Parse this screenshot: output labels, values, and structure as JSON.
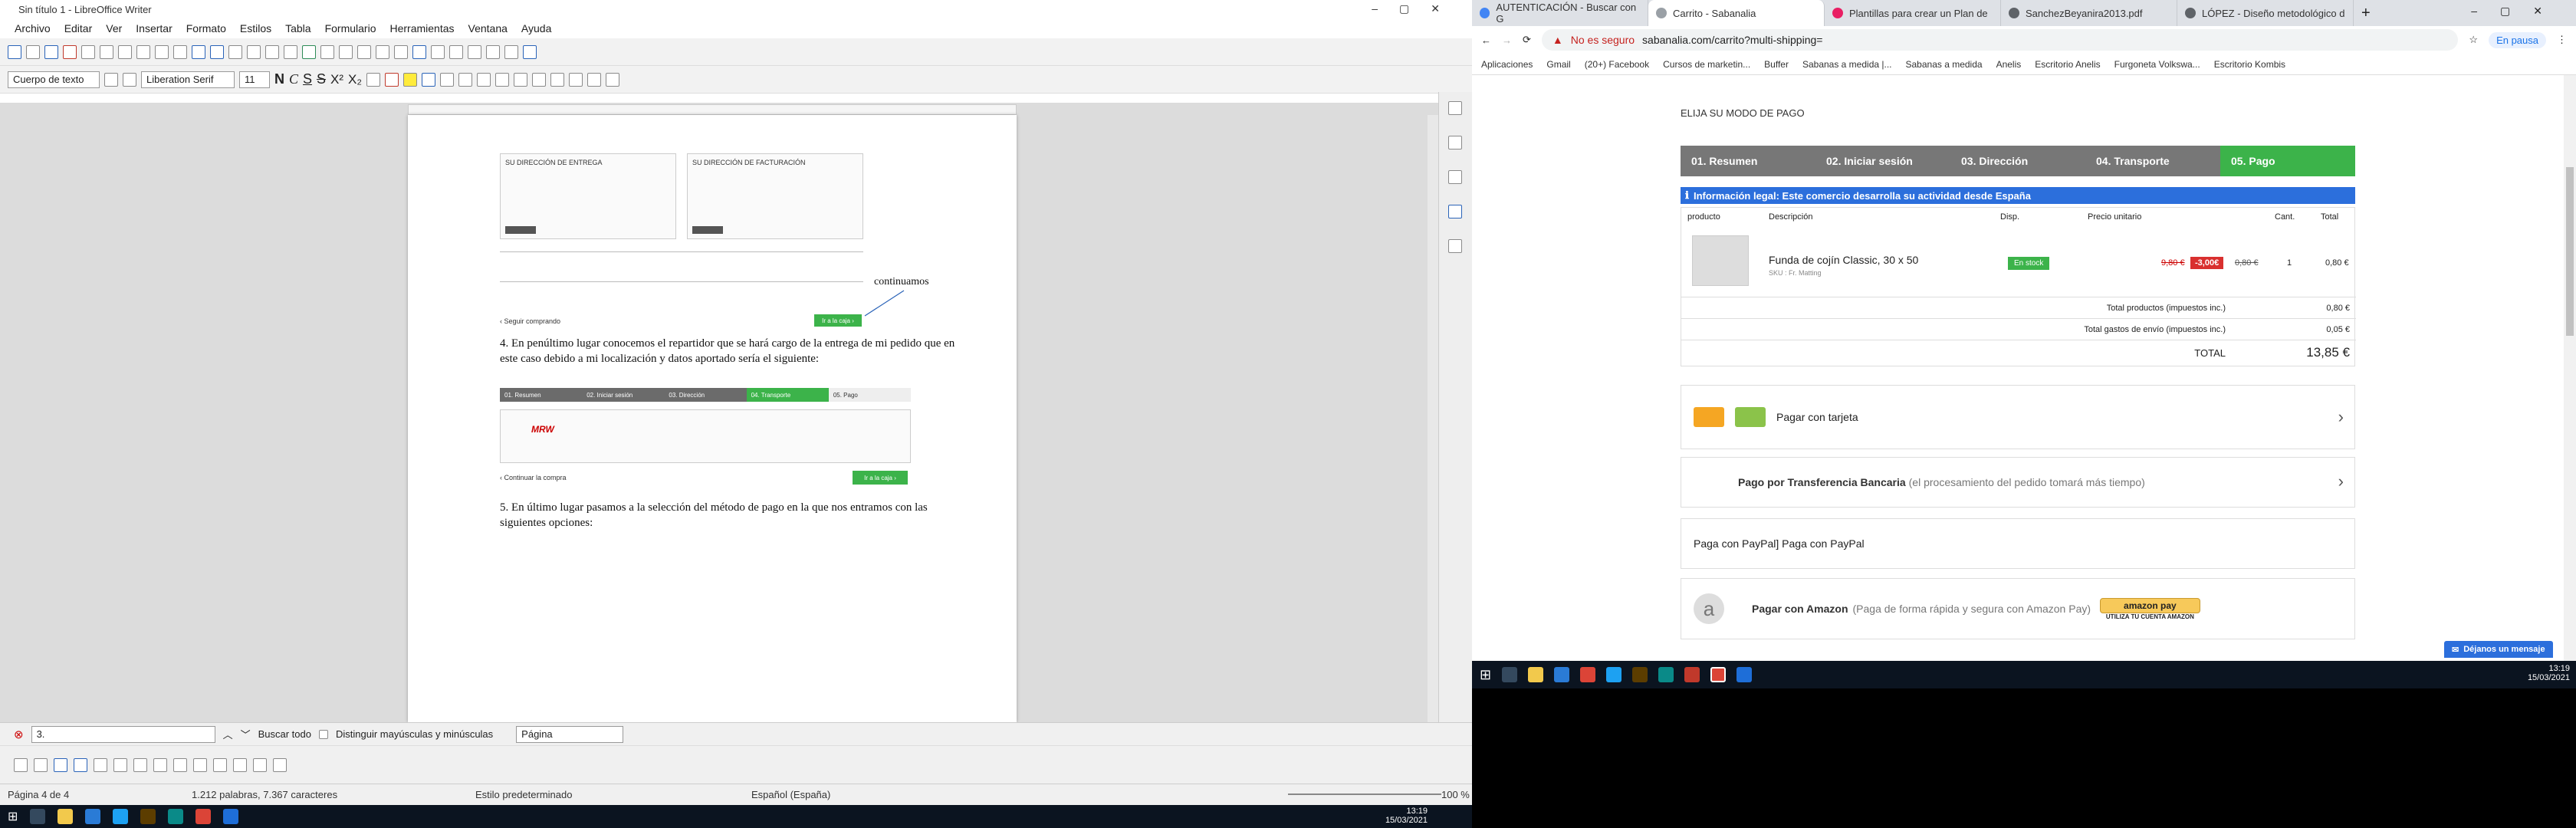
{
  "writer": {
    "title": "Sin título 1 - LibreOffice Writer",
    "menu": [
      "Archivo",
      "Editar",
      "Ver",
      "Insertar",
      "Formato",
      "Estilos",
      "Tabla",
      "Formulario",
      "Herramientas",
      "Ventana",
      "Ayuda"
    ],
    "para_style": "Cuerpo de texto",
    "font_name": "Liberation Serif",
    "font_size": "11",
    "doc": {
      "small_header_left": "SU DIRECCIÓN DE ENTREGA",
      "small_header_right": "SU DIRECCIÓN DE FACTURACIÓN",
      "annotation": "continuamos",
      "p4": "4. En penúltimo lugar conocemos el repartidor que se hará cargo de la entrega de mi pedido que en este caso debido a mi localización y datos aportado sería el siguiente:",
      "mini_steps": [
        "01. Resumen",
        "02. Iniciar sesión",
        "03. Dirección",
        "04. Transporte",
        "05. Pago"
      ],
      "mini_carrier": "MRW",
      "mini_btn": "Ir a la caja ›",
      "mini_continue": "‹ Continuar la compra",
      "mini_back": "‹ Seguir comprando",
      "p5": "5. En último lugar pasamos a la selección del método de pago en la que nos entramos con las siguientes opciones:"
    },
    "find": {
      "value": "3.",
      "find_all": "Buscar todo",
      "match_case": "Distinguir mayúsculas y minúsculas",
      "scope": "Página"
    },
    "status": {
      "page": "Página 4 de 4",
      "words": "1.212 palabras, 7.367 caracteres",
      "style": "Estilo predeterminado",
      "lang": "Español (España)",
      "zoom": "100 %"
    }
  },
  "browser": {
    "tabs": [
      {
        "label": "AUTENTICACIÓN - Buscar con G",
        "color": "#4285f4"
      },
      {
        "label": "Carrito - Sabanalia",
        "color": "#9aa0a6",
        "active": true
      },
      {
        "label": "Plantillas para crear un Plan de",
        "color": "#e91e63"
      },
      {
        "label": "SanchezBeyanira2013.pdf",
        "color": "#5f6368"
      },
      {
        "label": "LÓPEZ - Diseño metodológico d",
        "color": "#5f6368"
      }
    ],
    "security": "No es seguro",
    "url": "sabanalia.com/carrito?multi-shipping=",
    "profile": "En pausa",
    "bookmarks": [
      "Aplicaciones",
      "Gmail",
      "(20+) Facebook",
      "Cursos de marketin...",
      "Buffer",
      "Sabanas a medida |...",
      "Sabanas a medida",
      "Anelis",
      "Escritorio Anelis",
      "Furgoneta Volkswa...",
      "Escritorio Kombis"
    ],
    "heading": "ELIJA SU MODO DE PAGO",
    "steps": [
      "01. Resumen",
      "02. Iniciar sesión",
      "03. Dirección",
      "04. Transporte",
      "05. Pago"
    ],
    "legal": "Información legal: Este comercio desarrolla su actividad desde España",
    "table_headers": [
      "producto",
      "Descripción",
      "Disp.",
      "Precio unitario",
      "Cant.",
      "Total"
    ],
    "product": {
      "name": "Funda de cojín Classic, 30 x 50",
      "sub": "SKU : Fr. Matting",
      "stock": "En stock",
      "old_price": "9,80 €",
      "discount": "-3,00€",
      "price": "0,80 €",
      "qty": "1",
      "total": "0,80 €"
    },
    "totals": [
      {
        "label": "Total productos (impuestos inc.)",
        "value": "0,80 €"
      },
      {
        "label": "Total gastos de envío (impuestos inc.)",
        "value": "0,05 €"
      }
    ],
    "grand_label": "TOTAL",
    "grand_value": "13,85 €",
    "pay_card": "Pagar con tarjeta",
    "pay_transfer_bold": "Pago por Transferencia Bancaria",
    "pay_transfer_note": "(el procesamiento del pedido tomará más tiempo)",
    "pay_paypal": "Paga con PayPal] Paga con PayPal",
    "pay_amazon_bold": "Pagar con Amazon",
    "pay_amazon_note": "(Paga de forma rápida y segura con Amazon Pay)",
    "amazon_btn": "amazon pay",
    "amazon_sub": "UTILIZA TU CUENTA AMAZON",
    "chat": "Déjanos un mensaje"
  },
  "clock": {
    "time": "13:19",
    "date": "15/03/2021"
  }
}
